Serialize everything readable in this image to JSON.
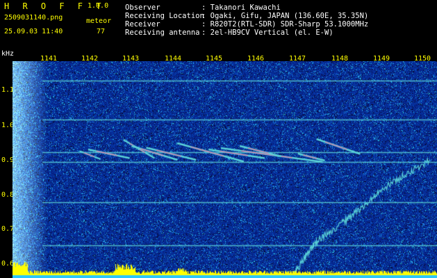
{
  "header": {
    "app_title": "H R O F F T",
    "version": "1.0.0",
    "filename": "2509031140.png",
    "datetime": "25.09.03 11:40",
    "meteor_label": "meteor",
    "meteor_count": "77"
  },
  "info": [
    {
      "key": "Observer",
      "value": ": Takanori Kawachi"
    },
    {
      "key": "Receiving Location",
      "value": ": Ogaki, Gifu, JAPAN (136.60E, 35.35N)"
    },
    {
      "key": "Receiver",
      "value": ": R820T2(RTL-SDR) SDR-Sharp 53.1000MHz"
    },
    {
      "key": "Receiving antenna",
      "value": ": 2el-HB9CV Vertical (el. E-W)"
    }
  ],
  "chart_data": {
    "type": "heatmap",
    "ylabel": "kHz",
    "x_ticks": [
      "1141",
      "1142",
      "1143",
      "1144",
      "1145",
      "1146",
      "1147",
      "1148",
      "1149",
      "1150"
    ],
    "y_ticks": [
      "1.1",
      "1.0",
      "0.9",
      "0.8",
      "0.7",
      "0.6"
    ],
    "xlim": [
      1140.6,
      1150.2
    ],
    "ylim": [
      0.57,
      1.17
    ],
    "carrier_lines_khz": [
      1.128,
      1.016,
      0.922,
      0.895,
      0.778,
      0.655
    ],
    "meteor_traces": [
      {
        "x1": 1141.75,
        "y1": 0.925,
        "x2": 1142.25,
        "y2": 0.902
      },
      {
        "x1": 1141.95,
        "y1": 0.93,
        "x2": 1142.95,
        "y2": 0.905
      },
      {
        "x1": 1142.8,
        "y1": 0.958,
        "x2": 1143.55,
        "y2": 0.905
      },
      {
        "x1": 1143.0,
        "y1": 0.94,
        "x2": 1144.1,
        "y2": 0.9
      },
      {
        "x1": 1143.35,
        "y1": 0.935,
        "x2": 1144.55,
        "y2": 0.9
      },
      {
        "x1": 1144.1,
        "y1": 0.948,
        "x2": 1145.7,
        "y2": 0.895
      },
      {
        "x1": 1144.85,
        "y1": 0.93,
        "x2": 1146.2,
        "y2": 0.905
      },
      {
        "x1": 1145.15,
        "y1": 0.934,
        "x2": 1147.6,
        "y2": 0.894
      },
      {
        "x1": 1145.6,
        "y1": 0.94,
        "x2": 1146.6,
        "y2": 0.91
      },
      {
        "x1": 1147.0,
        "y1": 0.918,
        "x2": 1147.65,
        "y2": 0.898
      },
      {
        "x1": 1147.45,
        "y1": 0.96,
        "x2": 1148.5,
        "y2": 0.917
      }
    ],
    "interference_drift": [
      {
        "x": 1146.9,
        "y": 0.57
      },
      {
        "x": 1147.4,
        "y": 0.66
      },
      {
        "x": 1148.2,
        "y": 0.73
      },
      {
        "x": 1149.2,
        "y": 0.83
      },
      {
        "x": 1150.2,
        "y": 0.9
      }
    ],
    "grid": false,
    "legend": "none"
  },
  "colors": {
    "background": "#000000",
    "noise": "#0a1d9a",
    "label": "#ffff00",
    "text": "#ffffff",
    "carrier": "#5ad2d8",
    "meteor_core": "#ff5fa0",
    "amplitude_bar": "#ffff00",
    "baseline": "#29c6ff"
  }
}
